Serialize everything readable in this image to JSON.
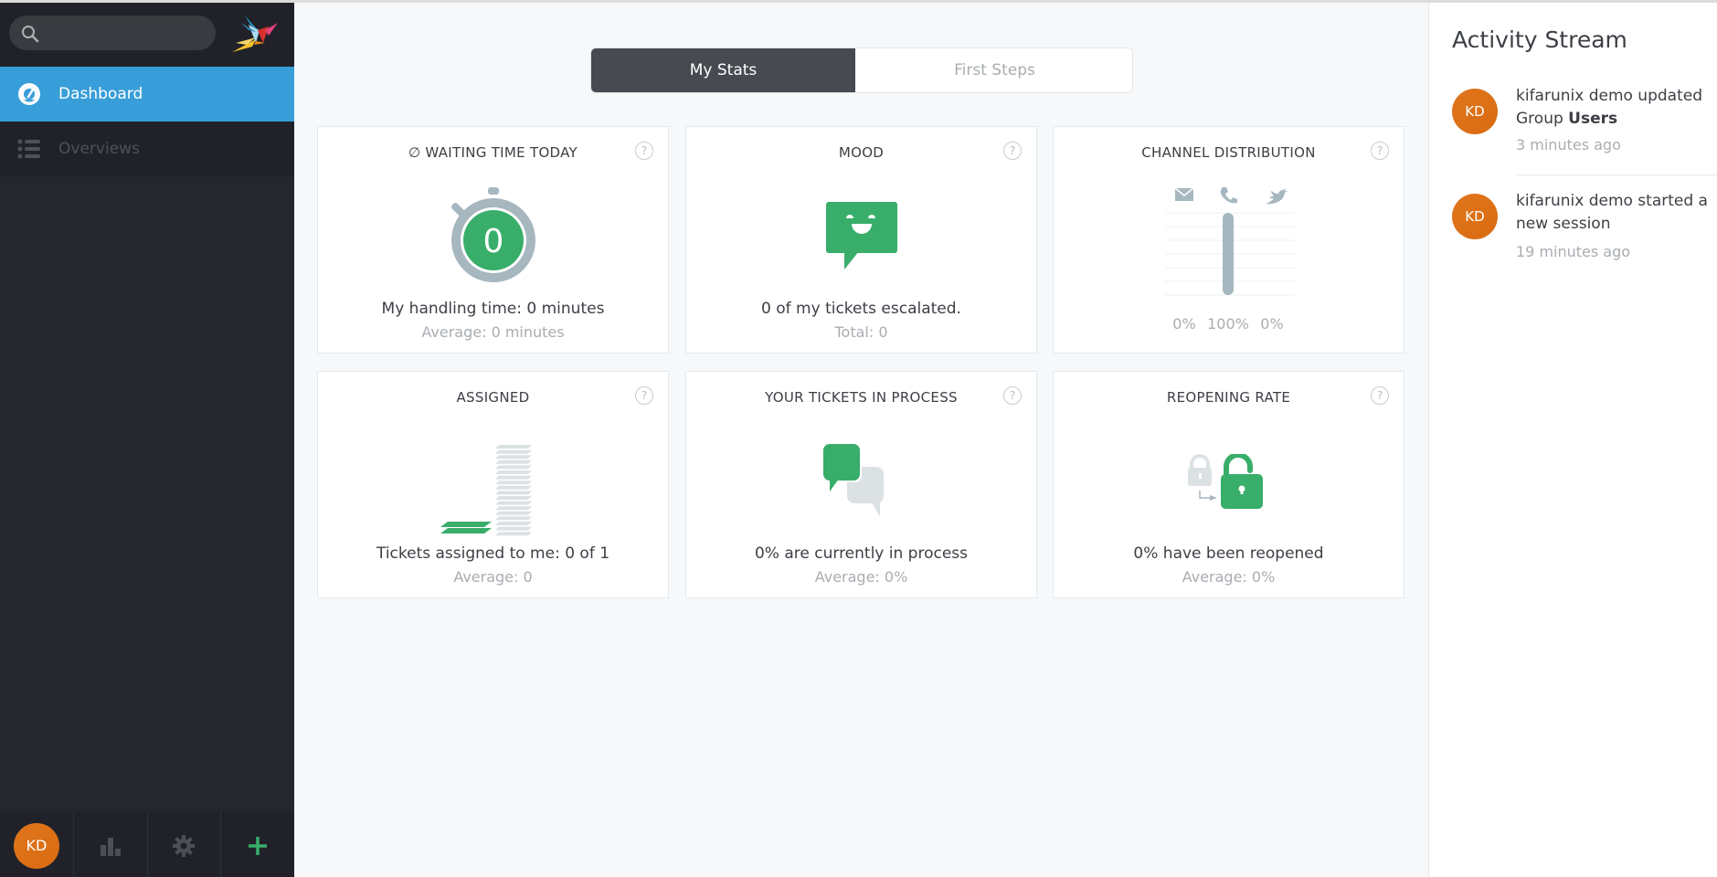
{
  "sidebar": {
    "search": {
      "placeholder": "",
      "value": ""
    },
    "nav": [
      {
        "label": "Dashboard",
        "icon": "dashboard-gauge-icon",
        "active": true
      },
      {
        "label": "Overviews",
        "icon": "list-icon",
        "active": false
      }
    ],
    "bottom": {
      "avatar_initials": "KD",
      "items": [
        "reports-icon",
        "settings-gear-icon",
        "new-plus-icon"
      ]
    }
  },
  "tabs": [
    {
      "label": "My Stats",
      "active": true
    },
    {
      "label": "First Steps",
      "active": false
    }
  ],
  "cards": {
    "waiting_time": {
      "title": "∅ WAITING TIME TODAY",
      "value": "0",
      "main": "My handling time: 0 minutes",
      "sub": "Average: 0 minutes"
    },
    "mood": {
      "title": "MOOD",
      "main": "0 of my tickets escalated.",
      "sub": "Total: 0"
    },
    "channel": {
      "title": "CHANNEL DISTRIBUTION",
      "channels": [
        {
          "icon": "email-icon",
          "percent": 0,
          "label": "0%"
        },
        {
          "icon": "phone-icon",
          "percent": 100,
          "label": "100%"
        },
        {
          "icon": "twitter-icon",
          "percent": 0,
          "label": "0%"
        }
      ]
    },
    "assigned": {
      "title": "ASSIGNED",
      "main": "Tickets assigned to me: 0 of 1",
      "sub": "Average: 0"
    },
    "in_process": {
      "title": "YOUR TICKETS IN PROCESS",
      "main": "0% are currently in process",
      "sub": "Average: 0%"
    },
    "reopening": {
      "title": "REOPENING RATE",
      "main": "0% have been reopened",
      "sub": "Average: 0%"
    },
    "help_label": "?"
  },
  "activity": {
    "title": "Activity Stream",
    "items": [
      {
        "initials": "KD",
        "text_pre": "kifarunix demo updated Group ",
        "text_bold": "Users",
        "time": "3 minutes ago"
      },
      {
        "initials": "KD",
        "text_pre": "kifarunix demo started a new session",
        "text_bold": "",
        "time": "19 minutes ago"
      }
    ]
  },
  "colors": {
    "accent": "#389ed9",
    "green": "#38ae6a",
    "avatar": "#e0761c",
    "sidebar": "#26272e"
  }
}
